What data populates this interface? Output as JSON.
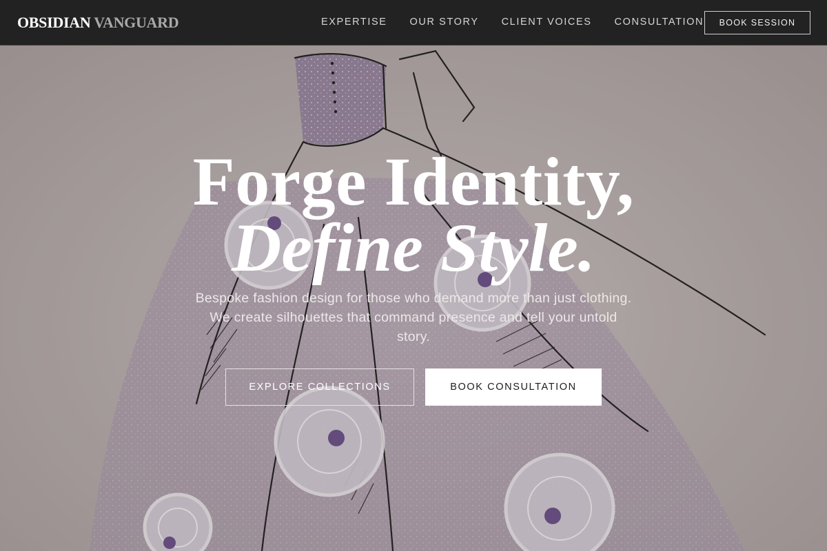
{
  "brand": {
    "name_primary": "OBSIDIAN",
    "name_secondary": "VANGUARD"
  },
  "nav": {
    "links": [
      {
        "label": "EXPERTISE"
      },
      {
        "label": "OUR STORY"
      },
      {
        "label": "CLIENT VOICES"
      },
      {
        "label": "CONSULTATION"
      }
    ],
    "cta_label": "BOOK SESSION"
  },
  "hero": {
    "headline_line1": "Forge Identity,",
    "headline_line2": "Define Style.",
    "subtitle": "Bespoke fashion design for those who demand more than just clothing. We create silhouettes that command presence and tell your untold story.",
    "primary_button": "EXPLORE COLLECTIONS",
    "secondary_button": "BOOK CONSULTATION"
  },
  "colors": {
    "nav_background": "#222222",
    "hero_tint": "#bdb6b3",
    "dress_lilac": "#9d8aa8",
    "accent_white": "#ffffff"
  }
}
